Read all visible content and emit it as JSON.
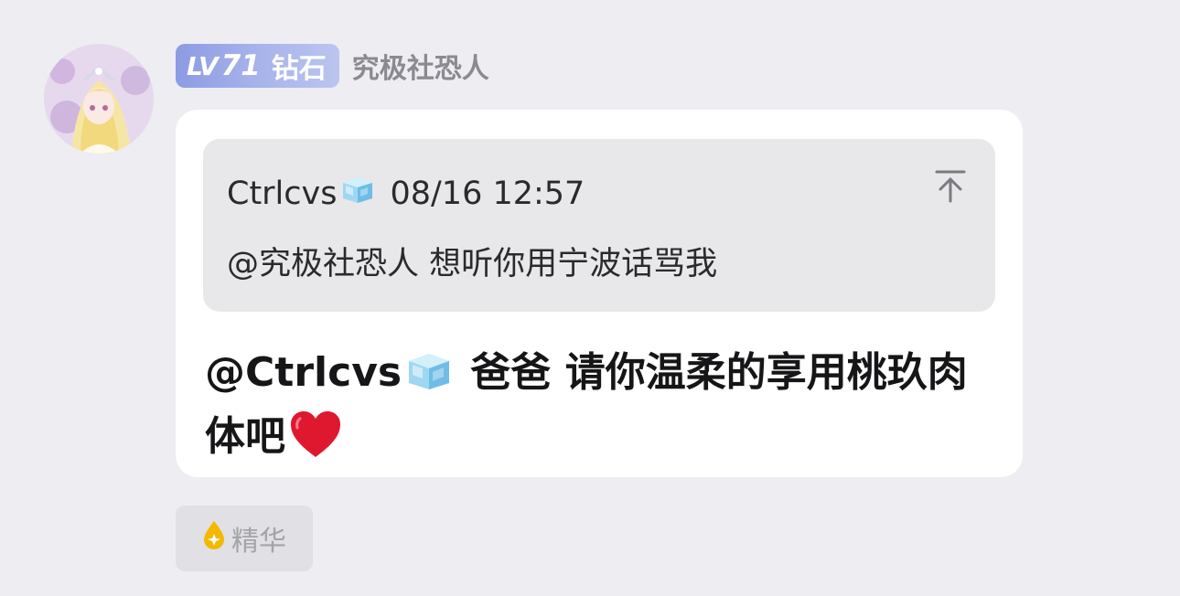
{
  "user": {
    "level_prefix": "LV",
    "level_number": "71",
    "level_tier": "钻石",
    "name": "究极社恐人",
    "badge_colors": [
      "#8c9be3",
      "#bcc5ef"
    ]
  },
  "quote": {
    "author": "Ctrlcvs",
    "timestamp": "08/16 12:57",
    "text": "@究极社恐人 想听你用宁波话骂我"
  },
  "message": {
    "mention": "@Ctrlcvs",
    "text": "爸爸 请你温柔的享用桃玖肉体吧"
  },
  "reaction": {
    "label": "精华",
    "icon": "flame-drop-icon",
    "color": "#f5b800"
  },
  "icons": {
    "avatar": "anime-avatar",
    "author_emoji": "ice-cube-icon",
    "quote_action": "pin-top-icon",
    "message_emoji": "red-heart-icon"
  }
}
